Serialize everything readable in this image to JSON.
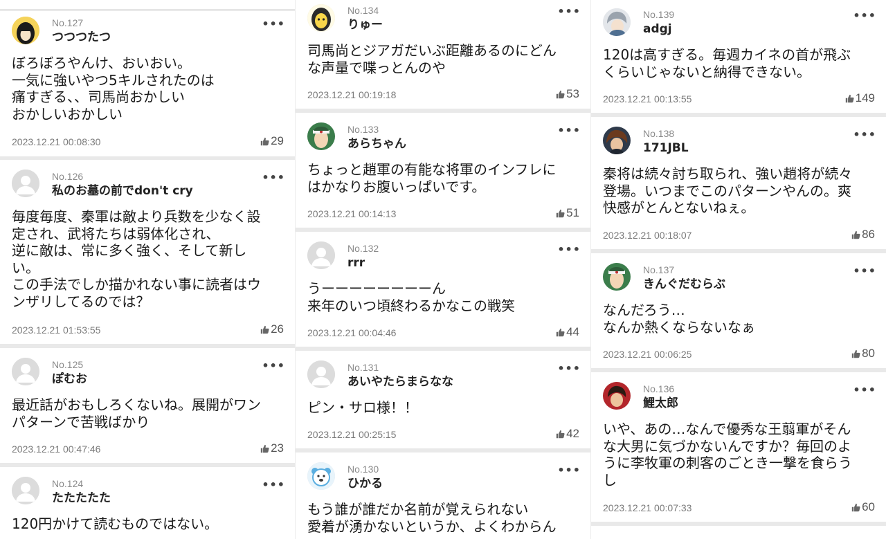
{
  "columns": [
    {
      "comments": [
        {
          "no": "No.127",
          "user": "つつつたつ",
          "avatar": "black-hair-avatar",
          "text": "ぼろぼろやんけ、おいおい。\n一気に強いやつ5キルされたのは\n痛すぎる、、司馬尚おかしい\nおかしいおかしい",
          "date": "2023.12.21 00:08:30",
          "likes": "29"
        },
        {
          "no": "No.126",
          "user": "私のお墓の前でdon't cry",
          "avatar": "default-avatar",
          "text": "毎度毎度、秦軍は敵より兵数を少なく設\n定され、武将たちは弱体化され、\n逆に敵は、常に多く強く、そして新し\nい。\nこの手法でしか描かれない事に読者はウ\nンザリしてるのでは？",
          "date": "2023.12.21 01:53:55",
          "likes": "26"
        },
        {
          "no": "No.125",
          "user": "ぽむお",
          "avatar": "default-avatar",
          "text": "最近話がおもしろくないね。展開がワン\nパターンで苦戦ばかり",
          "date": "2023.12.21 00:47:46",
          "likes": "23"
        },
        {
          "no": "No.124",
          "user": "たたたたた",
          "avatar": "default-avatar",
          "text": "120円かけて読むものではない。",
          "date": "",
          "likes": ""
        }
      ]
    },
    {
      "comments": [
        {
          "no": "No.134",
          "user": "りゅー",
          "avatar": "yellow-face-avatar",
          "text": "司馬尚とジアガだいぶ距離あるのにどん\nな声量で喋っとんのや",
          "date": "2023.12.21 00:19:18",
          "likes": "53"
        },
        {
          "no": "No.133",
          "user": "あらちゃん",
          "avatar": "headband-avatar",
          "text": "ちょっと趙軍の有能な将軍のインフレに\nはかなりお腹いっぱいです。",
          "date": "2023.12.21 00:14:13",
          "likes": "51"
        },
        {
          "no": "No.132",
          "user": "rrr",
          "avatar": "default-avatar",
          "text": "うーーーーーーーーん\n来年のいつ頃終わるかなこの戦笑",
          "date": "2023.12.21 00:04:46",
          "likes": "44"
        },
        {
          "no": "No.131",
          "user": "あいやたらまらなな",
          "avatar": "default-avatar",
          "text": "ピン・サロ様！！",
          "date": "2023.12.21 00:25:15",
          "likes": "42"
        },
        {
          "no": "No.130",
          "user": "ひかる",
          "avatar": "bear-avatar",
          "text": "もう誰が誰だか名前が覚えられない\n愛着が湧かないというか、よくわからん",
          "date": "",
          "likes": ""
        }
      ]
    },
    {
      "comments": [
        {
          "no": "No.139",
          "user": "adgj",
          "avatar": "gray-hair-avatar",
          "text": "120は高すぎる。毎週カイネの首が飛ぶ\nくらいじゃないと納得できない。",
          "date": "2023.12.21 00:13:55",
          "likes": "149"
        },
        {
          "no": "No.138",
          "user": "171JBL",
          "avatar": "brown-hair-avatar",
          "text": "秦将は続々討ち取られ、強い趙将が続々\n登場。いつまでこのパターンやんの。爽\n快感がとんとないねぇ。",
          "date": "2023.12.21 00:18:07",
          "likes": "86"
        },
        {
          "no": "No.137",
          "user": "きんぐだむらぶ",
          "avatar": "headband-avatar",
          "text": "なんだろう…\nなんか熱くならないなぁ",
          "date": "2023.12.21 00:06:25",
          "likes": "80"
        },
        {
          "no": "No.136",
          "user": "鯉太郎",
          "avatar": "red-bg-avatar",
          "text": "いや、あの…なんで優秀な王翦軍がそん\nな大男に気づかないんですか？毎回のよ\nうに李牧軍の刺客のごとき一撃を食らう\nし",
          "date": "2023.12.21 00:07:33",
          "likes": "60"
        }
      ]
    }
  ],
  "more_label": "•••",
  "colors": {
    "background": "#e9e9e9",
    "card": "#ffffff",
    "muted": "#8a8a8a"
  }
}
